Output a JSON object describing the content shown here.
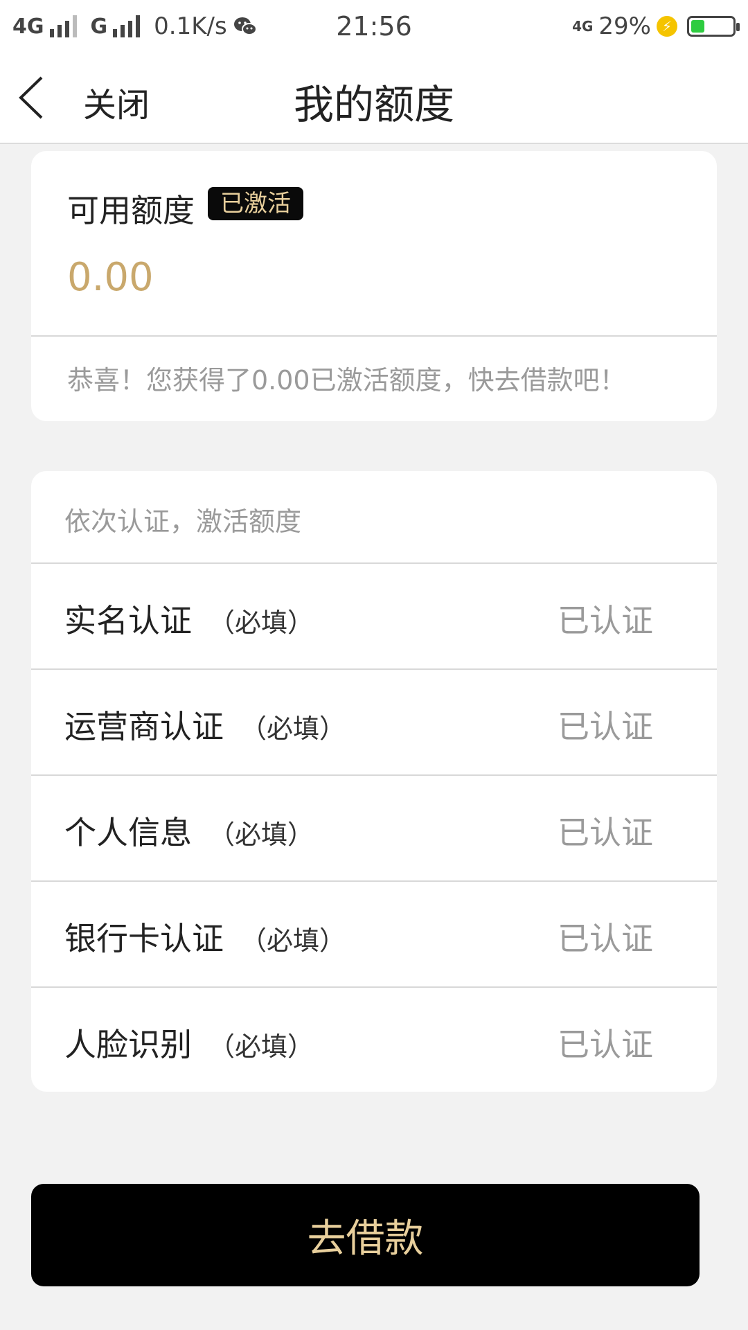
{
  "status_bar": {
    "network1": "4G",
    "network2": "G",
    "speed": "0.1K/s",
    "time": "21:56",
    "network3": "4G",
    "battery_percent": "29%",
    "battery_level": 0.29,
    "icons": [
      "signal-icon",
      "wechat-icon",
      "charging-icon",
      "battery-icon"
    ]
  },
  "nav": {
    "close_label": "关闭",
    "title": "我的额度"
  },
  "quota": {
    "title": "可用额度",
    "badge": "已激活",
    "amount": "0.00",
    "message": "恭喜！您获得了0.00已激活额度，快去借款吧！"
  },
  "verification": {
    "header": "依次认证，激活额度",
    "items": [
      {
        "name": "实名认证",
        "required": "（必填）",
        "status": "已认证"
      },
      {
        "name": "运营商认证",
        "required": "（必填）",
        "status": "已认证"
      },
      {
        "name": "个人信息",
        "required": "（必填）",
        "status": "已认证"
      },
      {
        "name": "银行卡认证",
        "required": "（必填）",
        "status": "已认证"
      },
      {
        "name": "人脸识别",
        "required": "（必填）",
        "status": "已认证"
      }
    ]
  },
  "action": {
    "borrow_label": "去借款"
  },
  "colors": {
    "accent_gold": "#c9a86c",
    "button_text": "#e8cf9c",
    "button_bg": "#000000",
    "muted_text": "#9a9a9a"
  }
}
